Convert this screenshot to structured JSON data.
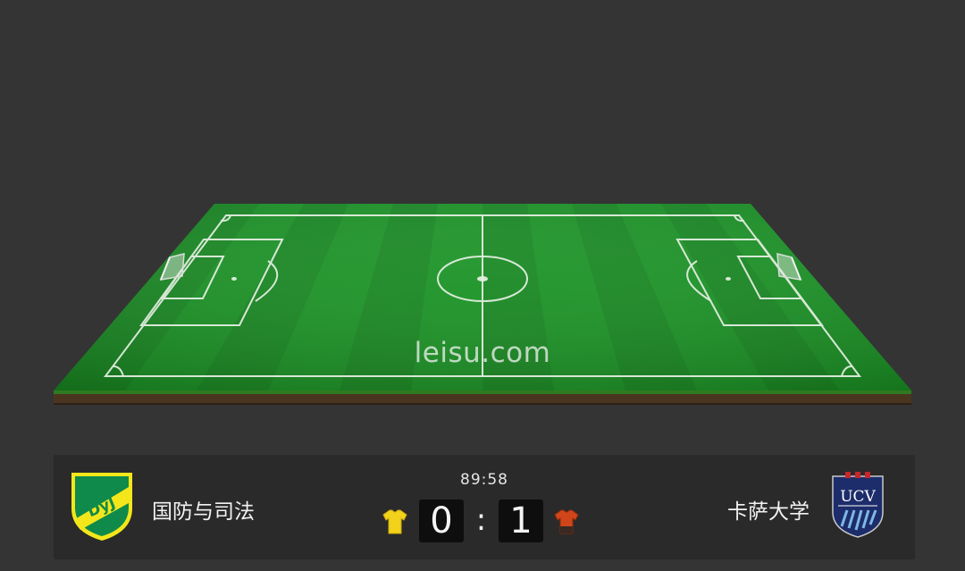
{
  "watermark": "leisu.com",
  "match": {
    "time": "89:58",
    "separator": ":",
    "home": {
      "name": "国防与司法",
      "score": "0",
      "logo_text": "DyJ",
      "logo_colors": {
        "primary": "#0f8a4a",
        "secondary": "#f3e61b"
      },
      "shirt_color": "#f2d21a"
    },
    "away": {
      "name": "卡萨大学",
      "score": "1",
      "logo_text": "UCV",
      "logo_colors": {
        "primary": "#1d2d6b",
        "secondary": "#c8262c",
        "stripes": "#7fb8e6"
      },
      "shirt_color": "#d0461a"
    }
  },
  "icons": {
    "home_shirt": "jersey-icon",
    "away_shirt": "jersey-icon"
  }
}
